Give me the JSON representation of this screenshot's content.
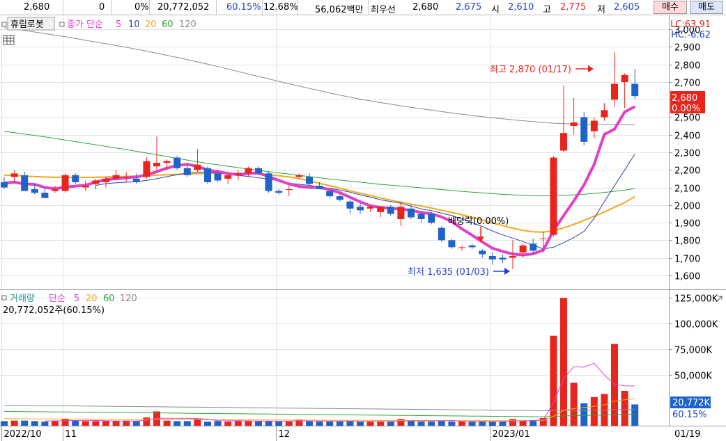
{
  "topbar": {
    "price": "2,680",
    "change": "0",
    "change_pct": "0%",
    "volume": "20,772,052",
    "vol_ratio": "60.15%",
    "turnover": "12.68%",
    "amount": "56,062백만",
    "bid_label": "최우선",
    "bid1": "2,680",
    "bid2": "2,675",
    "open_label": "시",
    "open": "2,610",
    "high_label": "고",
    "high": "2,775",
    "low_label": "저",
    "low": "2,605",
    "buy_label": "매수",
    "sell_label": "매도"
  },
  "colors": {
    "up": "#e8251d",
    "down": "#1f63c8",
    "ma5": "#e13fc8",
    "ma10": "#2c3fae",
    "ma20": "#f0a81e",
    "ma60": "#2ea33a",
    "ma120": "#8a8a8a",
    "grid": "#e2e2e2",
    "frame": "#9a9a9a"
  },
  "chart_data": [
    {
      "type": "candlestick",
      "stock": "휴림로봇",
      "indicator": {
        "label": "종가 단순",
        "periods": [
          "5",
          "10",
          "20",
          "60",
          "120"
        ]
      },
      "x_ticks": [
        {
          "label": "2022/10",
          "index": 0
        },
        {
          "label": "11",
          "index": 6
        },
        {
          "label": "12",
          "index": 27
        },
        {
          "label": "2023/01",
          "index": 48
        },
        {
          "label": "01/19",
          "index": 61
        }
      ],
      "y_ticks": [
        "3,000",
        "2,900",
        "2,800",
        "2,700",
        "2,600",
        "2,500",
        "2,400",
        "2,300",
        "2,200",
        "2,100",
        "2,000",
        "1,900",
        "1,800",
        "1,700",
        "1,600"
      ],
      "ylim": [
        1520,
        3080
      ],
      "lc": "LC:63.91",
      "hc": "HC:-6.62",
      "current_price": "2,680",
      "current_pct": "0.00%",
      "high_note": "최고 2,870 (01/17)",
      "low_note": "최저 1,635 (01/03)",
      "dividend_note": "배당락(0.00%)",
      "candles": [
        [
          2130,
          2160,
          2090,
          2100
        ],
        [
          2160,
          2200,
          2130,
          2180
        ],
        [
          2170,
          2190,
          2080,
          2080
        ],
        [
          2090,
          2120,
          2060,
          2070
        ],
        [
          2070,
          2100,
          2040,
          2040
        ],
        [
          2080,
          2110,
          2070,
          2090
        ],
        [
          2080,
          2180,
          2070,
          2170
        ],
        [
          2170,
          2180,
          2120,
          2130
        ],
        [
          2100,
          2140,
          2080,
          2110
        ],
        [
          2120,
          2150,
          2090,
          2140
        ],
        [
          2130,
          2160,
          2100,
          2150
        ],
        [
          2150,
          2200,
          2140,
          2170
        ],
        [
          2160,
          2190,
          2130,
          2160
        ],
        [
          2150,
          2180,
          2120,
          2130
        ],
        [
          2160,
          2270,
          2150,
          2250
        ],
        [
          2220,
          2390,
          2200,
          2240
        ],
        [
          2240,
          2260,
          2200,
          2250
        ],
        [
          2270,
          2280,
          2200,
          2210
        ],
        [
          2210,
          2230,
          2160,
          2170
        ],
        [
          2200,
          2320,
          2190,
          2230
        ],
        [
          2210,
          2220,
          2120,
          2130
        ],
        [
          2180,
          2200,
          2130,
          2140
        ],
        [
          2150,
          2180,
          2120,
          2170
        ],
        [
          2170,
          2200,
          2140,
          2180
        ],
        [
          2180,
          2220,
          2160,
          2210
        ],
        [
          2210,
          2220,
          2170,
          2180
        ],
        [
          2180,
          2190,
          2070,
          2080
        ],
        [
          2080,
          2090,
          2060,
          2070
        ],
        [
          2090,
          2110,
          2050,
          2090
        ],
        [
          2160,
          2180,
          2150,
          2170
        ],
        [
          2160,
          2180,
          2110,
          2120
        ],
        [
          2110,
          2130,
          2090,
          2090
        ],
        [
          2080,
          2090,
          2040,
          2050
        ],
        [
          2050,
          2060,
          2020,
          2030
        ],
        [
          2020,
          2030,
          1950,
          1980
        ],
        [
          1990,
          2010,
          1950,
          1970
        ],
        [
          1980,
          2000,
          1960,
          1990
        ],
        [
          1960,
          1990,
          1930,
          1990
        ],
        [
          1990,
          2000,
          1940,
          1950
        ],
        [
          1920,
          2020,
          1880,
          1990
        ],
        [
          1980,
          2000,
          1920,
          1930
        ],
        [
          1950,
          1960,
          1900,
          1920
        ],
        [
          1950,
          1960,
          1890,
          1900
        ],
        [
          1870,
          1880,
          1790,
          1800
        ],
        [
          1800,
          1810,
          1750,
          1760
        ],
        [
          1760,
          1770,
          1740,
          1760
        ],
        [
          1770,
          1780,
          1750,
          1760
        ],
        [
          1740,
          1750,
          1700,
          1720
        ],
        [
          1710,
          1730,
          1660,
          1690
        ],
        [
          1700,
          1720,
          1670,
          1690
        ],
        [
          1700,
          1800,
          1635,
          1710
        ],
        [
          1730,
          1780,
          1700,
          1770
        ],
        [
          1780,
          1810,
          1720,
          1740
        ],
        [
          1810,
          1850,
          1730,
          1810
        ],
        [
          1830,
          2280,
          1820,
          2270
        ],
        [
          2310,
          2680,
          2300,
          2410
        ],
        [
          2450,
          2610,
          2400,
          2470
        ],
        [
          2500,
          2530,
          2340,
          2360
        ],
        [
          2420,
          2500,
          2380,
          2480
        ],
        [
          2500,
          2580,
          2480,
          2540
        ],
        [
          2600,
          2870,
          2560,
          2690
        ],
        [
          2700,
          2750,
          2550,
          2740
        ],
        [
          2690,
          2775,
          2605,
          2620
        ]
      ],
      "ma5": [
        2125,
        2130,
        2120,
        2118,
        2100,
        2093,
        2102,
        2108,
        2113,
        2130,
        2145,
        2150,
        2155,
        2160,
        2172,
        2190,
        2210,
        2225,
        2232,
        2220,
        2200,
        2190,
        2180,
        2173,
        2180,
        2182,
        2163,
        2140,
        2120,
        2106,
        2100,
        2100,
        2088,
        2070,
        2044,
        2018,
        1996,
        1986,
        1982,
        1976,
        1970,
        1958,
        1950,
        1932,
        1906,
        1864,
        1828,
        1790,
        1754,
        1736,
        1721,
        1716,
        1722,
        1744,
        1854,
        1940,
        2024,
        2114,
        2232,
        2402,
        2432,
        2530,
        2560
      ],
      "ma10": [
        null,
        null,
        null,
        null,
        null,
        null,
        null,
        null,
        null,
        2112,
        2122,
        2127,
        2130,
        2133,
        2140,
        2150,
        2162,
        2172,
        2182,
        2188,
        2187,
        2183,
        2175,
        2168,
        2163,
        2155,
        2148,
        2138,
        2125,
        2118,
        2112,
        2103,
        2095,
        2085,
        2073,
        2058,
        2045,
        2030,
        2020,
        2010,
        1994,
        1978,
        1968,
        1954,
        1940,
        1920,
        1900,
        1878,
        1852,
        1830,
        1812,
        1792,
        1772,
        1750,
        1760,
        1786,
        1815,
        1850,
        1925,
        2020,
        2110,
        2200,
        2290
      ],
      "ma20": [
        2170,
        2168,
        2165,
        2162,
        2160,
        2158,
        2158,
        2157,
        2157,
        2158,
        2160,
        2162,
        2163,
        2165,
        2167,
        2170,
        2172,
        2175,
        2177,
        2178,
        2180,
        2181,
        2181,
        2180,
        2178,
        2176,
        2172,
        2167,
        2160,
        2150,
        2138,
        2124,
        2110,
        2096,
        2081,
        2067,
        2054,
        2040,
        2028,
        2016,
        2005,
        1994,
        1983,
        1970,
        1958,
        1944,
        1930,
        1914,
        1898,
        1883,
        1868,
        1856,
        1848,
        1846,
        1854,
        1870,
        1890,
        1912,
        1936,
        1960,
        1988,
        2014,
        2048
      ],
      "ma60": [
        2420,
        2412,
        2404,
        2396,
        2388,
        2379,
        2370,
        2361,
        2352,
        2343,
        2334,
        2325,
        2316,
        2306,
        2296,
        2286,
        2276,
        2266,
        2256,
        2246,
        2237,
        2229,
        2221,
        2213,
        2205,
        2197,
        2190,
        2183,
        2176,
        2169,
        2162,
        2155,
        2148,
        2142,
        2136,
        2130,
        2124,
        2118,
        2113,
        2108,
        2103,
        2098,
        2093,
        2088,
        2083,
        2078,
        2073,
        2069,
        2065,
        2061,
        2058,
        2055,
        2053,
        2052,
        2053,
        2055,
        2058,
        2062,
        2066,
        2072,
        2078,
        2085,
        2093
      ],
      "ma120": [
        3010,
        3002,
        2994,
        2985,
        2976,
        2967,
        2958,
        2948,
        2938,
        2928,
        2918,
        2908,
        2898,
        2887,
        2876,
        2864,
        2852,
        2840,
        2828,
        2815,
        2802,
        2788,
        2774,
        2760,
        2746,
        2732,
        2718,
        2704,
        2690,
        2677,
        2664,
        2651,
        2638,
        2626,
        2614,
        2603,
        2593,
        2583,
        2574,
        2565,
        2556,
        2548,
        2540,
        2532,
        2524,
        2517,
        2510,
        2503,
        2497,
        2491,
        2485,
        2480,
        2475,
        2470,
        2466,
        2463,
        2461,
        2460,
        2459,
        2458,
        2458,
        2457,
        2457
      ]
    },
    {
      "type": "bar",
      "title": "거래량",
      "indicator": {
        "label": "단순",
        "periods": [
          "5",
          "20",
          "60",
          "120"
        ]
      },
      "current_label": "20,772,052주(60.15%)",
      "y_ticks": [
        "125,000K",
        "100,000K",
        "75,000K",
        "50,000K"
      ],
      "ylim": [
        0,
        132000
      ],
      "current_value": "20,772K",
      "current_pct": "60.15%",
      "volumes": [
        4500,
        5000,
        5000,
        4500,
        4000,
        4500,
        6500,
        5000,
        4500,
        4500,
        4500,
        4500,
        5000,
        4500,
        8000,
        14000,
        5000,
        4500,
        4500,
        7000,
        4000,
        4500,
        4000,
        4500,
        5000,
        4500,
        4500,
        4000,
        4000,
        6000,
        4500,
        4000,
        4000,
        4000,
        4500,
        4000,
        4000,
        4000,
        4000,
        6500,
        4500,
        4000,
        4000,
        4500,
        4000,
        4000,
        4000,
        4000,
        4000,
        4000,
        6500,
        5000,
        5500,
        7500,
        88000,
        125000,
        42000,
        22000,
        28000,
        31000,
        80000,
        34000,
        20772
      ],
      "vma5": [
        null,
        null,
        null,
        null,
        4600,
        4700,
        4900,
        5100,
        5300,
        5100,
        4800,
        4600,
        4600,
        4600,
        5300,
        7200,
        7300,
        7200,
        7200,
        7000,
        6300,
        4900,
        4800,
        4900,
        4500,
        4600,
        4500,
        4500,
        4400,
        4800,
        4600,
        4600,
        4500,
        4500,
        4500,
        4100,
        4100,
        4100,
        4100,
        4500,
        4700,
        4700,
        4700,
        4800,
        5100,
        4300,
        4100,
        4100,
        4000,
        4000,
        4500,
        4700,
        5100,
        5800,
        22800,
        46200,
        57600,
        57200,
        61000,
        49600,
        40600,
        39000,
        38800
      ],
      "vma20": [
        7000,
        6900,
        6800,
        6700,
        6700,
        6600,
        6600,
        6500,
        6500,
        6400,
        6300,
        6300,
        6200,
        6200,
        6100,
        6100,
        6000,
        6000,
        5900,
        5900,
        5800,
        5800,
        5800,
        5700,
        5700,
        5700,
        5600,
        5600,
        5500,
        5500,
        5500,
        5400,
        5400,
        5400,
        5300,
        5300,
        5300,
        5200,
        5200,
        5200,
        5100,
        5100,
        5100,
        5000,
        5000,
        5000,
        4900,
        4900,
        4900,
        4800,
        4900,
        4900,
        5000,
        5000,
        9100,
        15100,
        16900,
        17800,
        19000,
        20300,
        24000,
        25400,
        26300
      ],
      "vma60": [
        14000,
        13900,
        13800,
        13700,
        13600,
        13500,
        13400,
        13300,
        13200,
        13100,
        13000,
        12900,
        12800,
        12700,
        12600,
        12500,
        12400,
        12300,
        12200,
        12100,
        12000,
        11900,
        11800,
        11700,
        11600,
        11500,
        11400,
        11300,
        11200,
        11100,
        11000,
        10900,
        10800,
        10700,
        10600,
        10500,
        10400,
        10300,
        10200,
        10100,
        10000,
        9900,
        9800,
        9700,
        9600,
        9500,
        9400,
        9300,
        9200,
        9100,
        9000,
        8900,
        8800,
        8800,
        9000,
        9500,
        9800,
        10000,
        10200,
        10400,
        10900,
        11100,
        11300
      ],
      "vma120": [
        20000,
        19900,
        19800,
        19700,
        19600,
        19500,
        19400,
        19300,
        19200,
        19100,
        19000,
        18900,
        18800,
        18700,
        18600,
        18500,
        18400,
        18300,
        18200,
        18100,
        18000,
        17900,
        17800,
        17700,
        17600,
        17500,
        17400,
        17300,
        17200,
        17100,
        17000,
        16900,
        16800,
        16700,
        16600,
        16500,
        16400,
        16300,
        16200,
        16100,
        16000,
        15900,
        15800,
        15700,
        15600,
        15500,
        15400,
        15300,
        15200,
        15100,
        15000,
        14900,
        14800,
        14700,
        14800,
        15000,
        15100,
        15200,
        15300,
        15400,
        15600,
        15700,
        15800
      ]
    }
  ]
}
